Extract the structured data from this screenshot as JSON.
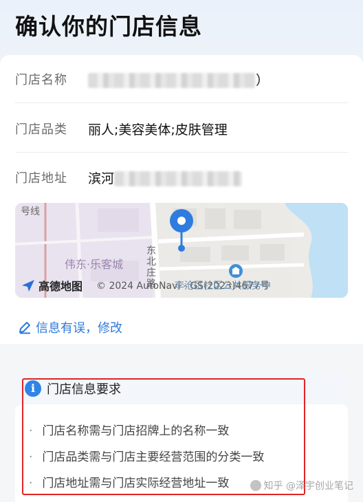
{
  "page": {
    "title": "确认你的门店信息"
  },
  "store": {
    "name_label": "门店名称",
    "name_value_tail": "）",
    "category_label": "门店品类",
    "category_value": "丽人;美容美体;皮肤管理",
    "address_label": "门店地址",
    "address_value_head": "滨河"
  },
  "map": {
    "district_label": "伟东·乐客城",
    "road_label_left": "号线",
    "road_label_right": "东北庄路",
    "logo_text": "高德地图",
    "copyright": "© 2024 AutoNavi - GS(2023)4677号",
    "poi_label": "李沧区社区公共服务中"
  },
  "edit": {
    "label": "信息有误，修改"
  },
  "requirements": {
    "title": "门店信息要求",
    "items": [
      "门店名称需与门店招牌上的名称一致",
      "门店品类需与门店主要经营范围的分类一致",
      "门店地址需与门店实际经营地址一致"
    ]
  },
  "watermark": {
    "text": "知乎 @泽宇创业笔记"
  },
  "colors": {
    "accent": "#2f7bd8",
    "highlight": "#e02424",
    "pin": "#2f7ce0"
  }
}
